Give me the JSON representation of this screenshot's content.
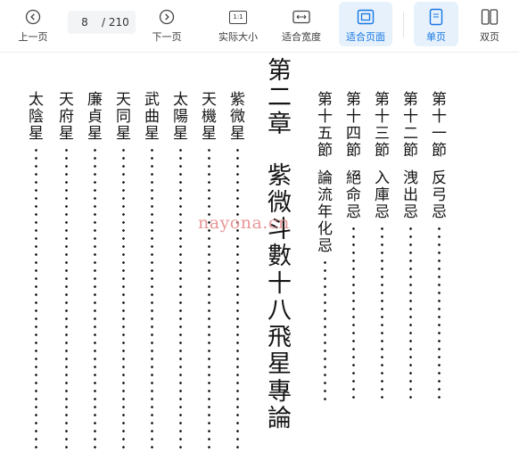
{
  "toolbar": {
    "prev_label": "上一页",
    "page_current": "8",
    "page_total": "/ 210",
    "next_label": "下一页",
    "actual_size_label": "实际大小",
    "actual_size_icon_text": "1:1",
    "fit_width_label": "适合宽度",
    "fit_page_label": "适合页面",
    "single_page_label": "单页",
    "double_page_label": "双页",
    "accent_color": "#1677e5"
  },
  "document": {
    "chapter_title": "第二章　紫微斗數十八飛星專論",
    "sections": [
      {
        "number": "第十一節",
        "title": "反弓忌"
      },
      {
        "number": "第十二節",
        "title": "洩出忌"
      },
      {
        "number": "第十三節",
        "title": "入庫忌"
      },
      {
        "number": "第十四節",
        "title": "絕命忌"
      },
      {
        "number": "第十五節",
        "title": "論流年化忌"
      }
    ],
    "stars": [
      "紫微星",
      "天機星",
      "太陽星",
      "武曲星",
      "天同星",
      "廉貞星",
      "天府星",
      "太陰星"
    ],
    "watermark": "nayona.cn"
  }
}
